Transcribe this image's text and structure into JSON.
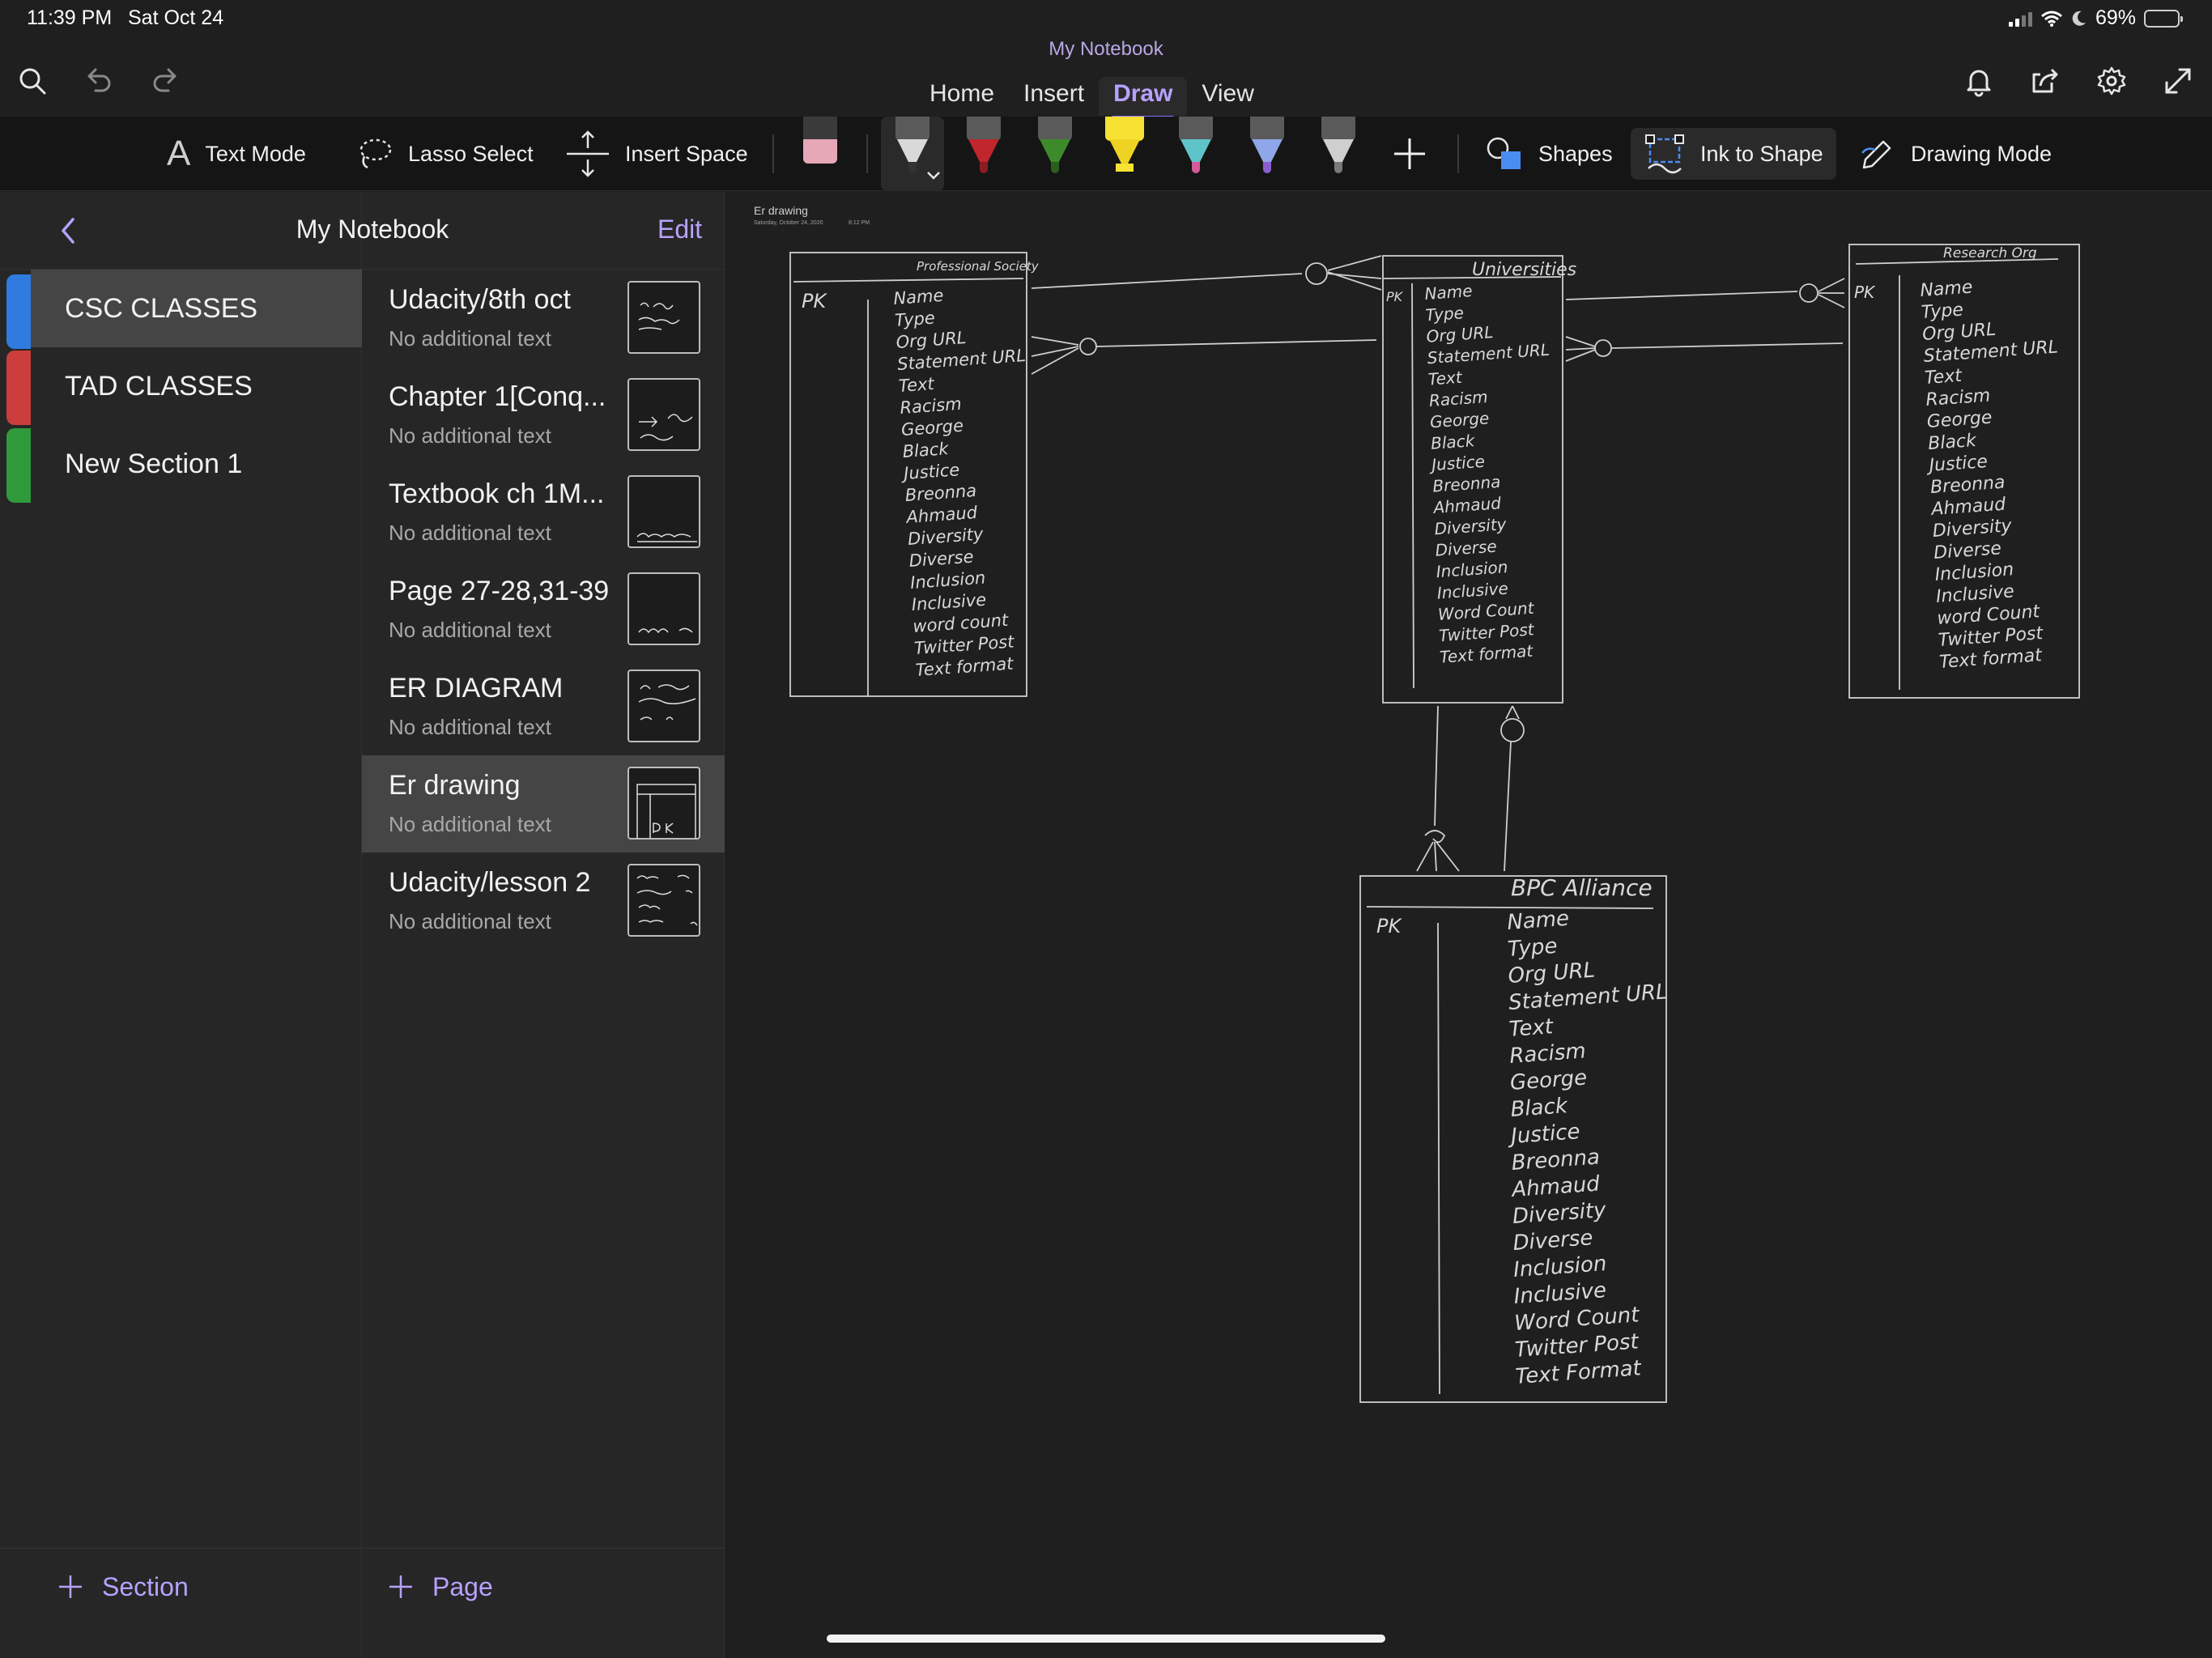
{
  "status": {
    "time": "11:39 PM",
    "date": "Sat Oct 24",
    "battery": "69%",
    "battery_level": 0.69
  },
  "app": {
    "notebook_title": "My Notebook"
  },
  "ribbon": {
    "tabs": [
      {
        "label": "Home"
      },
      {
        "label": "Insert"
      },
      {
        "label": "Draw",
        "active": true
      },
      {
        "label": "View"
      }
    ]
  },
  "toolbar": {
    "text_mode": "Text Mode",
    "lasso_select": "Lasso Select",
    "insert_space": "Insert Space",
    "shapes": "Shapes",
    "ink_to_shape": "Ink to Shape",
    "drawing_mode": "Drawing Mode",
    "pens": [
      {
        "name": "eraser",
        "color": "#e6a7b7"
      },
      {
        "name": "pen-white",
        "color": "#d9d9d9",
        "selected": true
      },
      {
        "name": "pen-red",
        "color": "#c0262b"
      },
      {
        "name": "pen-green",
        "color": "#3d8a2b"
      },
      {
        "name": "highlighter-yellow",
        "color": "#f7e234"
      },
      {
        "name": "pen-rainbow",
        "color": "#5fc4c9"
      },
      {
        "name": "pen-galaxy",
        "color": "#8fa6e8"
      },
      {
        "name": "pen-silver",
        "color": "#cfcfcf"
      }
    ]
  },
  "panel": {
    "title": "My Notebook",
    "edit": "Edit"
  },
  "sections": [
    {
      "label": "CSC CLASSES",
      "color": "#2f7be0",
      "active": true
    },
    {
      "label": "TAD CLASSES",
      "color": "#cc3d3d"
    },
    {
      "label": "New Section 1",
      "color": "#2f9a3a"
    }
  ],
  "pages": [
    {
      "title": "Udacity/8th oct",
      "subtitle": "No additional text"
    },
    {
      "title": "Chapter 1[Conq...",
      "subtitle": "No additional text"
    },
    {
      "title": "Textbook ch 1M...",
      "subtitle": "No additional text"
    },
    {
      "title": "Page 27-28,31-39",
      "subtitle": "No additional text"
    },
    {
      "title": "ER DIAGRAM",
      "subtitle": "No additional text"
    },
    {
      "title": "Er drawing",
      "subtitle": "No additional text",
      "active": true
    },
    {
      "title": "Udacity/lesson 2",
      "subtitle": "No additional text"
    }
  ],
  "footer": {
    "add_section": "Section",
    "add_page": "Page"
  },
  "canvas": {
    "page_title": "Er drawing",
    "page_date": "Saturday, October 24, 2020",
    "page_time": "8:12 PM",
    "entities": [
      {
        "title": "Professional Society",
        "key": "PK",
        "attributes": [
          "Name",
          "Type",
          "Org URL",
          "Statement URL",
          "Text",
          "Racism",
          "George",
          "Black",
          "Justice",
          "Breonna",
          "Ahmaud",
          "Diversity",
          "Diverse",
          "Inclusion",
          "Inclusive",
          "word count",
          "Twitter Post",
          "Text format"
        ]
      },
      {
        "title": "Universities",
        "key": "PK",
        "attributes": [
          "Name",
          "Type",
          "Org URL",
          "Statement URL",
          "Text",
          "Racism",
          "George",
          "Black",
          "Justice",
          "Breonna",
          "Ahmaud",
          "Diversity",
          "Diverse",
          "Inclusion",
          "Inclusive",
          "Word Count",
          "Twitter Post",
          "Text format"
        ]
      },
      {
        "title": "Research Org",
        "key": "PK",
        "attributes": [
          "Name",
          "Type",
          "Org URL",
          "Statement URL",
          "Text",
          "Racism",
          "George",
          "Black",
          "Justice",
          "Breonna",
          "Ahmaud",
          "Diversity",
          "Diverse",
          "Inclusion",
          "Inclusive",
          "word Count",
          "Twitter Post",
          "Text format"
        ]
      },
      {
        "title": "BPC Alliance",
        "key": "PK",
        "attributes": [
          "Name",
          "Type",
          "Org URL",
          "Statement URL",
          "Text",
          "Racism",
          "George",
          "Black",
          "Justice",
          "Breonna",
          "Ahmaud",
          "Diversity",
          "Diverse",
          "Inclusion",
          "Inclusive",
          "Word Count",
          "Twitter Post",
          "Text Format"
        ]
      }
    ]
  }
}
